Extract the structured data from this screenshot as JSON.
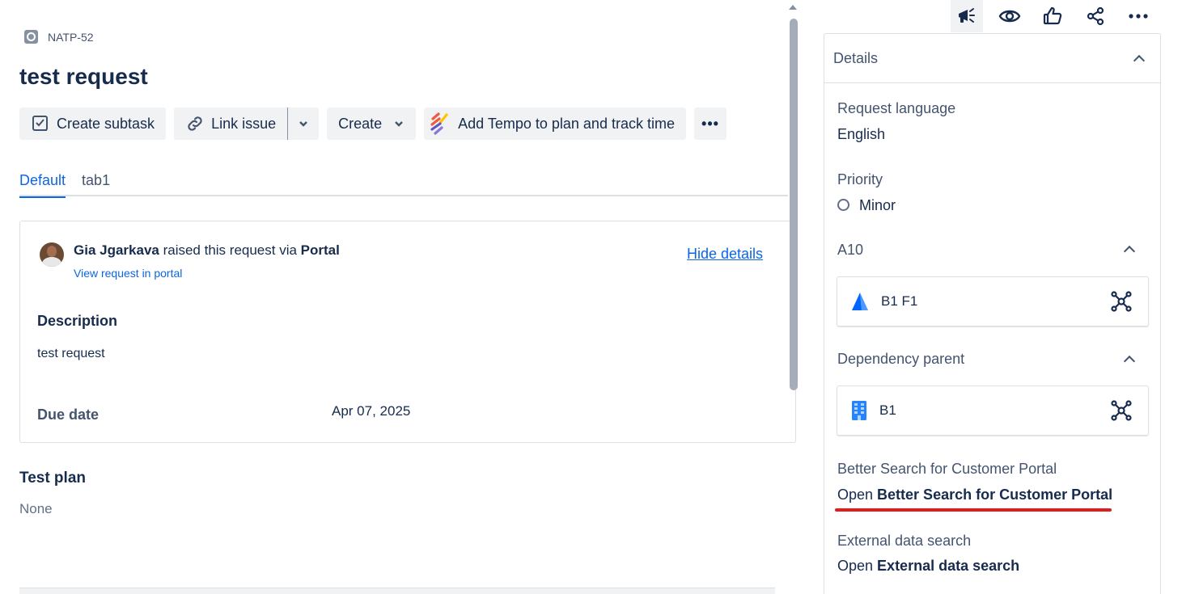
{
  "issue": {
    "key": "NATP-52",
    "title": "test request"
  },
  "toolbar": {
    "create_subtask": "Create subtask",
    "link_issue": "Link issue",
    "create": "Create",
    "tempo": "Add Tempo to plan and track time",
    "more": "•••"
  },
  "tabs": [
    {
      "label": "Default",
      "active": true
    },
    {
      "label": "tab1",
      "active": false
    }
  ],
  "request": {
    "reporter_name": "Gia Jgarkava",
    "raised_text": " raised this request via ",
    "channel": "Portal",
    "view_portal": "View request in portal",
    "hide_details": "Hide details",
    "description_label": "Description",
    "description": "test request",
    "due_label": "Due date",
    "due_value": "Apr 07, 2025"
  },
  "test_plan": {
    "label": "Test plan",
    "value": "None"
  },
  "details": {
    "title": "Details",
    "request_language_label": "Request language",
    "request_language_value": "English",
    "priority_label": "Priority",
    "priority_value": "Minor",
    "a10": {
      "label": "A10",
      "item": "B1 F1"
    },
    "dependency_parent": {
      "label": "Dependency parent",
      "item": "B1"
    },
    "better_search": {
      "label": "Better Search for Customer Portal",
      "open": "Open ",
      "link": "Better Search for Customer Portal"
    },
    "external_search": {
      "label": "External data search",
      "open": "Open ",
      "link": "External data search"
    }
  },
  "colors": {
    "accent": "#0c66e4",
    "text": "#172b4d",
    "subtle": "#44546f",
    "highlight_underline": "#e01c1c"
  }
}
